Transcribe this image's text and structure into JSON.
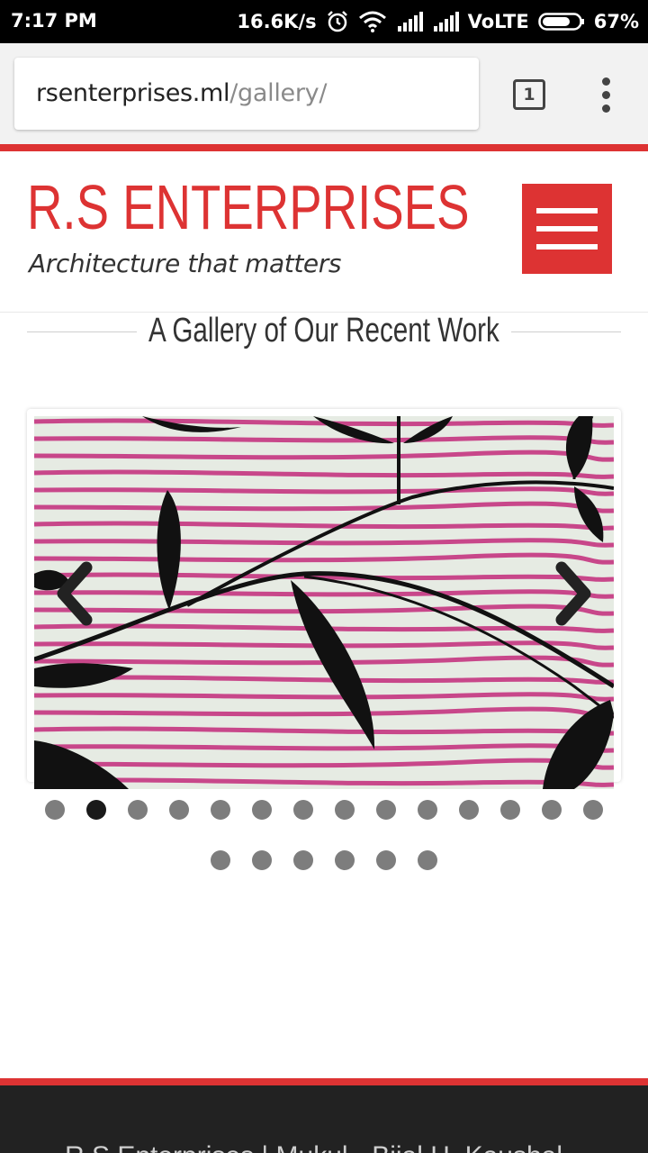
{
  "status_bar": {
    "time": "7:17 PM",
    "speed": "16.6K/s",
    "network": "VoLTE",
    "battery": "67%",
    "icons": [
      "alarm-icon",
      "wifi-icon",
      "signal-icon",
      "signal-icon",
      "battery-icon"
    ]
  },
  "browser": {
    "url_domain": "rsenterprises.ml",
    "url_path": "/gallery/",
    "tab_count": "1",
    "menu_icon": "more-vert-icon"
  },
  "site": {
    "title": "R.S ENTERPRISES",
    "tagline": "Architecture that matters",
    "menu_icon": "hamburger-icon",
    "brand_color": "#dd3333"
  },
  "gallery": {
    "heading": "A Gallery of Our Recent Work",
    "slide_count": 20,
    "active_index": 1,
    "prev_icon": "chevron-left-icon",
    "next_icon": "chevron-right-icon"
  },
  "footer": {
    "text": "R.S Enterprises | Mukul - Bijal  H. Kaushal"
  }
}
